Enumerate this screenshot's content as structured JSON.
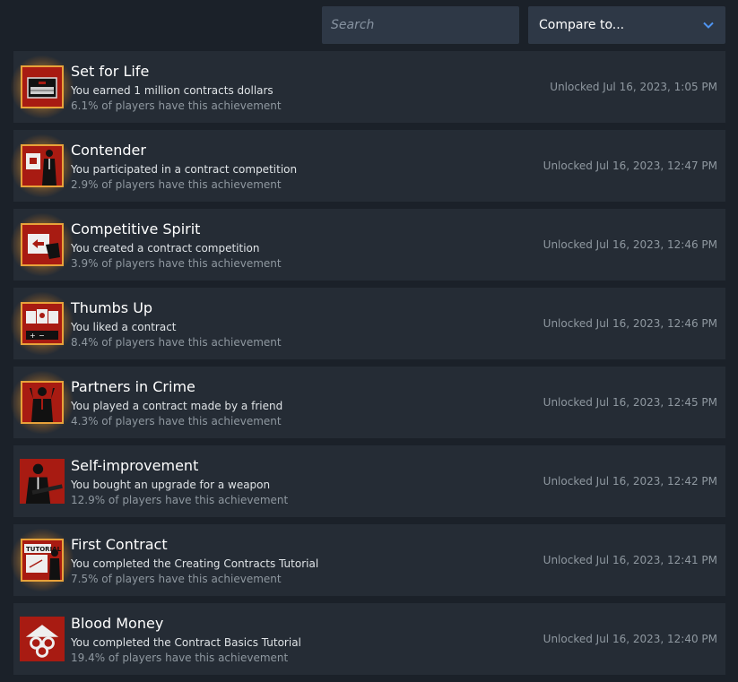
{
  "search": {
    "placeholder": "Search"
  },
  "compare": {
    "label": "Compare to...",
    "icon": "chevron-down-icon"
  },
  "colors": {
    "accent": "#4f94f0",
    "row_bg": "#252c35",
    "icon_red": "#a81b12",
    "glow": "#e8a23a"
  },
  "achievements": [
    {
      "title": "Set for Life",
      "desc": "You earned 1 million contracts dollars",
      "pct": "6.1% of players have this achievement",
      "unlocked": "Unlocked Jul 16, 2023, 1:05 PM",
      "icon": "briefcase-icon",
      "glow": true
    },
    {
      "title": "Contender",
      "desc": "You participated in a contract competition",
      "pct": "2.9% of players have this achievement",
      "unlocked": "Unlocked Jul 16, 2023, 12:47 PM",
      "icon": "agent-with-board-icon",
      "glow": true
    },
    {
      "title": "Competitive Spirit",
      "desc": "You created a contract competition",
      "pct": "3.9% of players have this achievement",
      "unlocked": "Unlocked Jul 16, 2023, 12:46 PM",
      "icon": "hand-with-card-icon",
      "glow": true
    },
    {
      "title": "Thumbs Up",
      "desc": "You liked a contract",
      "pct": "8.4% of players have this achievement",
      "unlocked": "Unlocked Jul 16, 2023, 12:46 PM",
      "icon": "rating-cards-icon",
      "glow": true
    },
    {
      "title": "Partners in Crime",
      "desc": "You played a contract made by a friend",
      "pct": "4.3% of players have this achievement",
      "unlocked": "Unlocked Jul 16, 2023, 12:45 PM",
      "icon": "agent-silhouette-icon",
      "glow": true
    },
    {
      "title": "Self-improvement",
      "desc": "You bought an upgrade for a weapon",
      "pct": "12.9% of players have this achievement",
      "unlocked": "Unlocked Jul 16, 2023, 12:42 PM",
      "icon": "agent-with-rifle-icon",
      "glow": false
    },
    {
      "title": "First Contract",
      "desc": "You completed the Creating Contracts Tutorial",
      "pct": "7.5% of players have this achievement",
      "unlocked": "Unlocked Jul 16, 2023, 12:41 PM",
      "icon": "tutorial-board-icon",
      "glow": true,
      "icon_text": "TUTORIAL"
    },
    {
      "title": "Blood Money",
      "desc": "You completed the Contract Basics Tutorial",
      "pct": "19.4% of players have this achievement",
      "unlocked": "Unlocked Jul 16, 2023, 12:40 PM",
      "icon": "coins-hand-icon",
      "glow": false
    }
  ]
}
